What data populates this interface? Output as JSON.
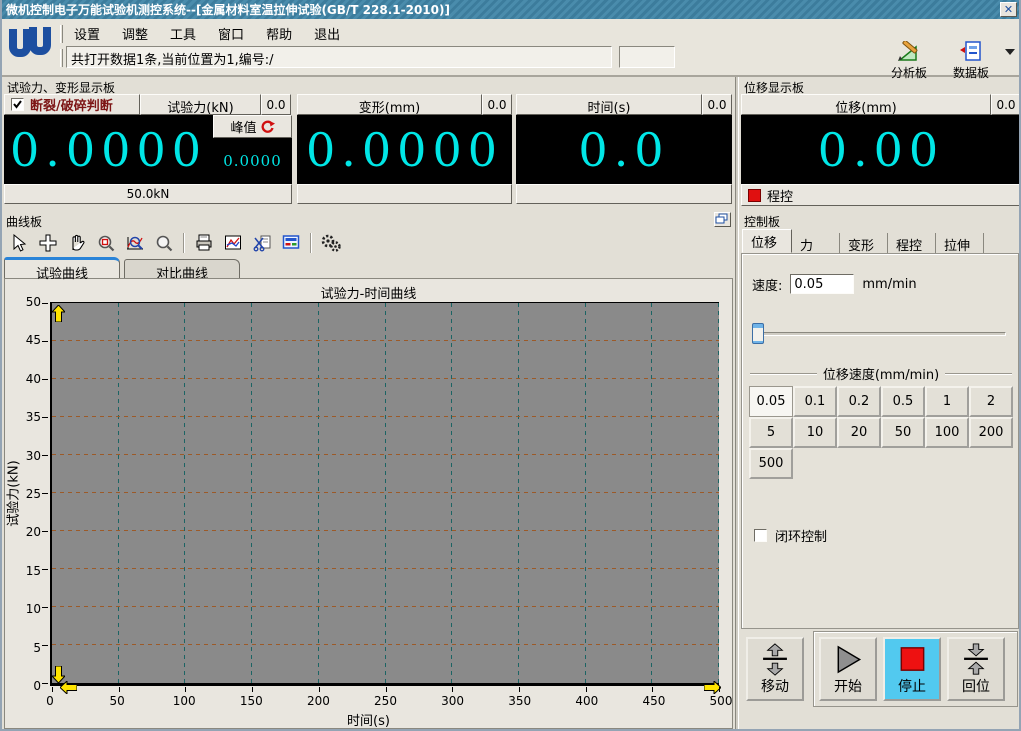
{
  "window": {
    "title": "微机控制电子万能试验机测控系统--[金属材料室温拉伸试验(GB/T 228.1-2010)]"
  },
  "menu": {
    "items": [
      "设置",
      "调整",
      "工具",
      "窗口",
      "帮助",
      "退出"
    ]
  },
  "statusbar": {
    "text": "共打开数据1条,当前位置为1,编号:/"
  },
  "topbar": {
    "analysis_label": "分析板",
    "data_label": "数据板"
  },
  "display_panel": {
    "title": "试验力、变形显示板",
    "break_label": "断裂/破碎判断",
    "break_checked": true,
    "force_header": "试验力(kN)",
    "force_aux": "0.0",
    "force_value": "0.0000",
    "peak_label": "峰值",
    "peak_value": "0.0000",
    "range_label": "50.0kN",
    "deform_header": "变形(mm)",
    "deform_aux": "0.0",
    "deform_value": "0.0000",
    "time_header": "时间(s)",
    "time_aux": "0.0",
    "time_value": "0.0"
  },
  "displacement_panel": {
    "title": "位移显示板",
    "header": "位移(mm)",
    "aux": "0.0",
    "value": "0.00",
    "mode_label": "程控"
  },
  "curve_panel": {
    "title": "曲线板",
    "tabs": [
      "试验曲线",
      "对比曲线"
    ],
    "active_tab": 0
  },
  "chart_data": {
    "type": "line",
    "title": "试验力-时间曲线",
    "xlabel": "时间(s)",
    "ylabel": "试验力(kN)",
    "xlim": [
      0,
      500
    ],
    "ylim": [
      0,
      50
    ],
    "xticks": [
      0,
      50,
      100,
      150,
      200,
      250,
      300,
      350,
      400,
      450,
      500
    ],
    "yticks": [
      0,
      5,
      10,
      15,
      20,
      25,
      30,
      35,
      40,
      45,
      50
    ],
    "series": [],
    "grid": true,
    "legend": false,
    "plot_bg": "#8a8a8a",
    "hgrid_color": "#9c5a28",
    "vgrid_color": "#1c6464"
  },
  "control_panel": {
    "title": "控制板",
    "tabs": [
      "位移",
      "力",
      "变形",
      "程控",
      "拉伸"
    ],
    "active_tab": 0,
    "speed_label": "速度:",
    "speed_value": "0.05",
    "speed_unit": "mm/min",
    "group_label": "位移速度(mm/min)",
    "speed_options": [
      "0.05",
      "0.1",
      "0.2",
      "0.5",
      "1",
      "2",
      "5",
      "10",
      "20",
      "50",
      "100",
      "200",
      "500"
    ],
    "selected_speed": "0.05",
    "closed_loop_label": "闭环控制",
    "closed_loop_checked": false,
    "move_label": "移动",
    "start_label": "开始",
    "stop_label": "停止",
    "home_label": "回位"
  },
  "colors": {
    "titlebar": "#417f9e",
    "lcd_text": "#00e6e6",
    "stop_button_bg": "#52c9ef",
    "alarm_red": "#e01010",
    "break_text_maroon": "#7d1616",
    "tab_accent_blue": "#2a84d8"
  }
}
